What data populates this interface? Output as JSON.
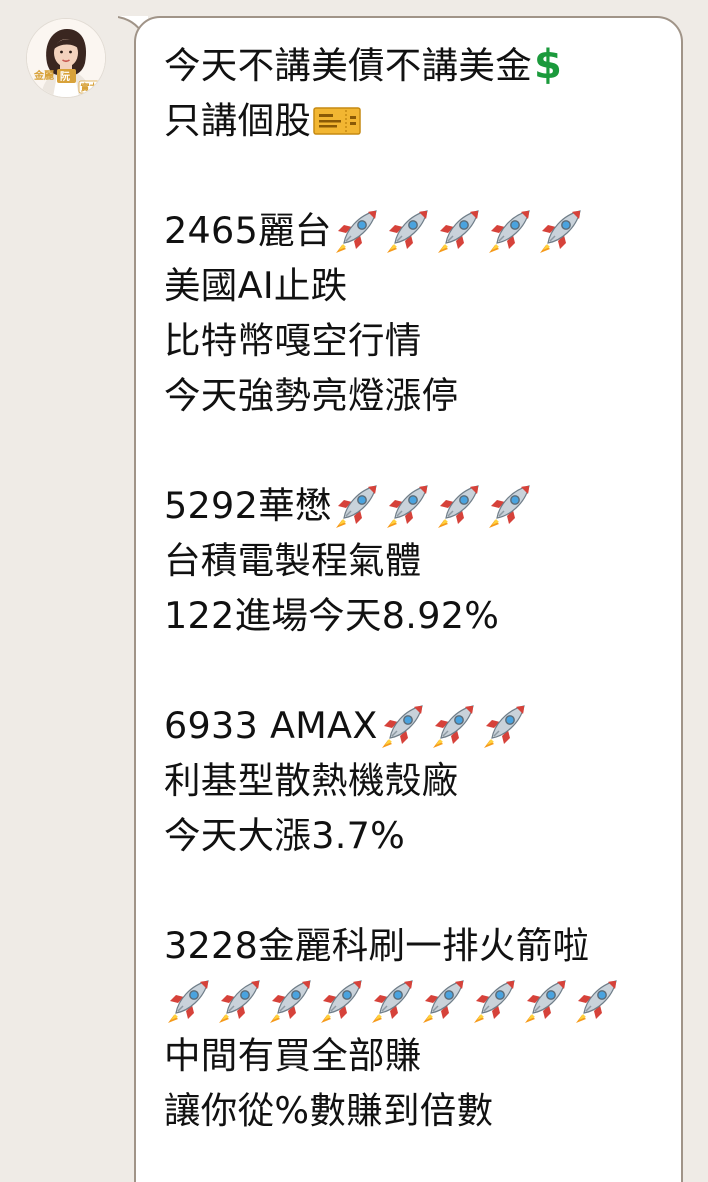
{
  "avatar": {
    "label_line1": "金麗",
    "label_badge": "阮",
    "label_line2": "實力"
  },
  "message": {
    "block1": {
      "line1": "今天不講美債不講美金",
      "line1_icon": "heavy-dollar-sign-icon",
      "line2": "只講個股",
      "line2_icon": "ticket-icon"
    },
    "block2": {
      "title": "2465麗台",
      "rocket_count": 5,
      "lines": [
        "美國AI止跌",
        "比特幣嘎空行情",
        "今天強勢亮燈漲停"
      ]
    },
    "block3": {
      "title": "5292華懋",
      "rocket_count": 4,
      "lines": [
        "台積電製程氣體",
        "122進場今天8.92%"
      ]
    },
    "block4": {
      "title": "6933 AMAX",
      "rocket_count": 3,
      "lines": [
        "利基型散熱機殼廠",
        "今天大漲3.7%"
      ]
    },
    "block5": {
      "title": "3228金麗科刷一排火箭啦",
      "rocket_count": 9,
      "lines": [
        "中間有買全部賺",
        "讓你從%數賺到倍數"
      ]
    }
  },
  "colors": {
    "background": "#efebe6",
    "bubble": "#ffffff",
    "bubble_border": "#a09488",
    "text": "#111111",
    "dollar": "#1b9a3c"
  }
}
